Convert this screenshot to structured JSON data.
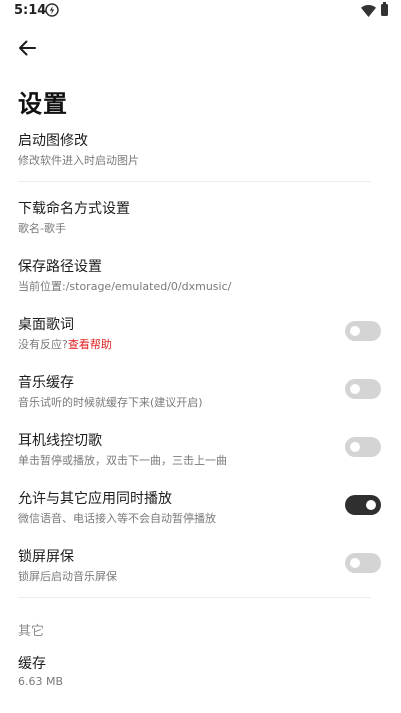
{
  "status_bar": {
    "time": "5:14",
    "icons": [
      "flash-icon",
      "wifi-icon",
      "battery-icon"
    ]
  },
  "header": {
    "back_icon": "arrow-left-icon",
    "title": "设置"
  },
  "settings": {
    "startup_image": {
      "title": "启动图修改",
      "subtitle": "修改软件进入时启动图片"
    },
    "download_naming": {
      "title": "下载命名方式设置",
      "subtitle": "歌名-歌手"
    },
    "save_path": {
      "title": "保存路径设置",
      "subtitle": "当前位置:/storage/emulated/0/dxmusic/"
    },
    "desktop_lyrics": {
      "title": "桌面歌词",
      "subtitle": "没有反应?",
      "help_link": "查看帮助",
      "enabled": false
    },
    "music_cache": {
      "title": "音乐缓存",
      "subtitle": "音乐试听的时候就缓存下来(建议开启)",
      "enabled": false
    },
    "headset_control": {
      "title": "耳机线控切歌",
      "subtitle": "单击暂停或播放，双击下一曲，三击上一曲",
      "enabled": false
    },
    "mix_playback": {
      "title": "允许与其它应用同时播放",
      "subtitle": "微信语音、电话接入等不会自动暂停播放",
      "enabled": true
    },
    "lock_screen": {
      "title": "锁屏屏保",
      "subtitle": "锁屏后启动音乐屏保",
      "enabled": false
    }
  },
  "other_section": {
    "header": "其它",
    "cache": {
      "title": "缓存",
      "subtitle": "6.63 MB"
    }
  },
  "colors": {
    "toggle_on": "#2f2f2f",
    "toggle_off": "#d4d4d4",
    "help_link": "#e02020"
  }
}
